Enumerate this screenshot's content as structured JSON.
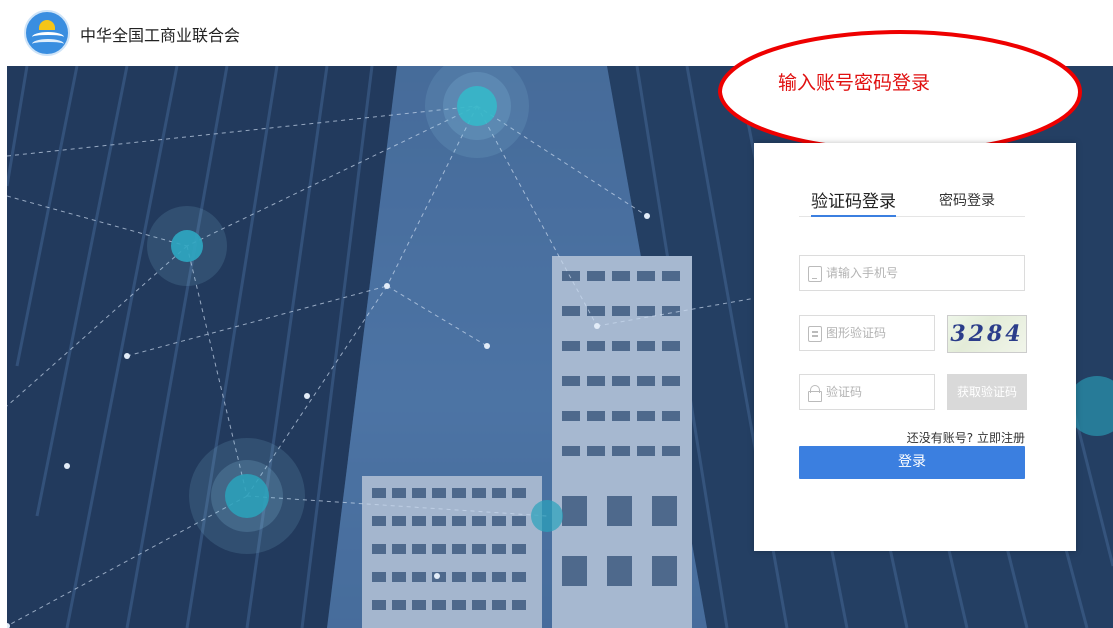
{
  "header": {
    "org_name": "中华全国工商业联合会",
    "logo_icon": "acfic-emblem-icon"
  },
  "callout": {
    "text": "输入账号密码登录",
    "border_color": "#ee0000"
  },
  "login": {
    "tabs": [
      {
        "label": "验证码登录",
        "active": true
      },
      {
        "label": "密码登录",
        "active": false
      }
    ],
    "phone_placeholder": "请输入手机号",
    "captcha_placeholder": "图形验证码",
    "captcha_value": "3284",
    "sms_placeholder": "验证码",
    "get_code_label": "获取验证码",
    "register_prompt": "还没有账号?",
    "register_link": "立即注册",
    "submit_label": "登录"
  },
  "colors": {
    "accent": "#3b7fe0",
    "disabled": "#d9d9d9",
    "callout_red": "#ee0000"
  }
}
